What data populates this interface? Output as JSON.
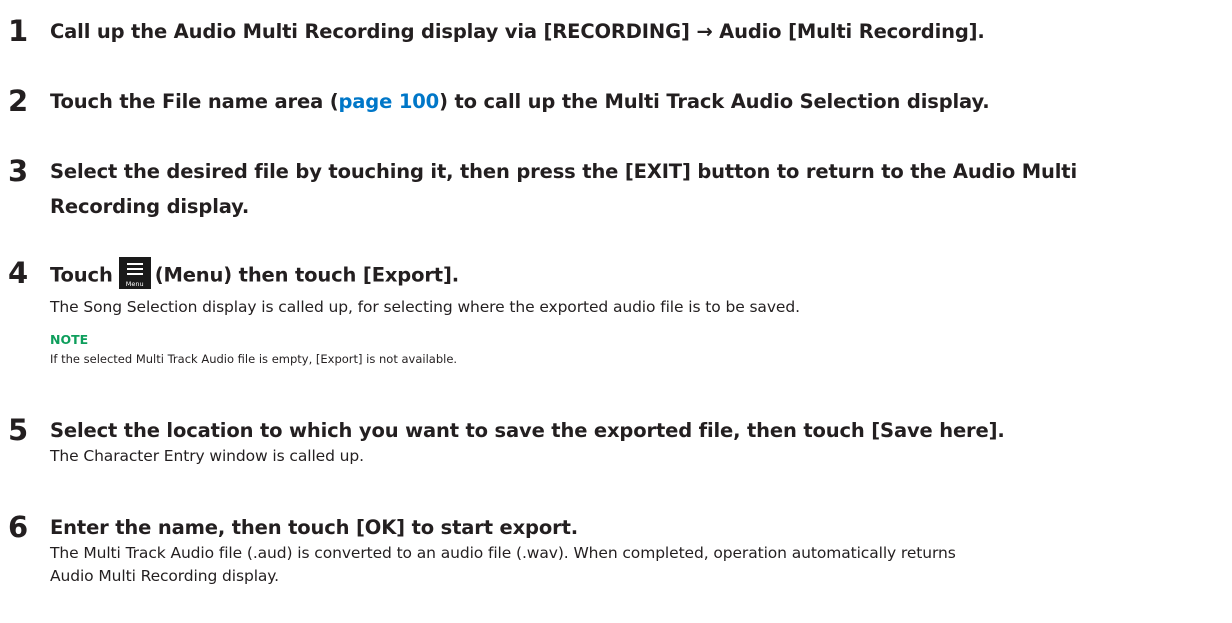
{
  "steps": [
    {
      "num": "1",
      "title": "Call up the Audio Multi Recording display via [RECORDING] → Audio [Multi Recording]."
    },
    {
      "num": "2",
      "title_before": "Touch the File name area (",
      "title_link": "page 100",
      "title_after": ") to call up the Multi Track Audio Selection display."
    },
    {
      "num": "3",
      "title_line1": "Select the desired file by touching it, then press the [EXIT] button to return to the Audio Multi",
      "title_line2": "Recording display."
    },
    {
      "num": "4",
      "title_before": "Touch",
      "icon_caption": "Menu",
      "title_after": "(Menu) then touch [Export].",
      "description": "The Song Selection display is called up, for selecting where the exported audio file is to be saved.",
      "note_label": "NOTE",
      "note_text": "If the selected Multi Track Audio file is empty, [Export] is not available."
    },
    {
      "num": "5",
      "title": "Select the location to which you want to save the exported file, then touch [Save here].",
      "description": "The Character Entry window is called up."
    },
    {
      "num": "6",
      "title": "Enter the name, then touch [OK] to start export.",
      "description_line1": "The Multi Track Audio file (.aud) is converted to an audio file (.wav). When completed, operation automatically returns",
      "description_line2": "Audio Multi Recording display."
    }
  ],
  "colors": {
    "text": "#231f20",
    "link": "#0077c8",
    "note": "#0e9e5c",
    "icon_bg": "#1a1a1a"
  },
  "icons": {
    "menu": "menu-icon"
  }
}
